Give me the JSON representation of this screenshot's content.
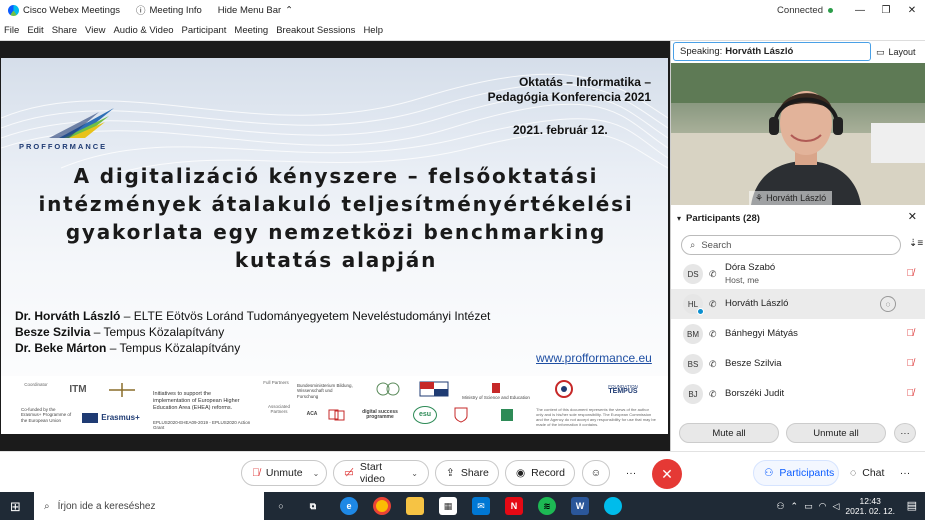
{
  "titlebar": {
    "app_title": "Cisco Webex Meetings",
    "meeting_info": "Meeting Info",
    "hide_menu": "Hide Menu Bar",
    "status": "Connected"
  },
  "menu": [
    "File",
    "Edit",
    "Share",
    "View",
    "Audio & Video",
    "Participant",
    "Meeting",
    "Breakout Sessions",
    "Help"
  ],
  "slide": {
    "logo_text": "PROFFORMANCE",
    "conference_line1": "Oktatás – Informatika –",
    "conference_line2": "Pedagógia Konferencia 2021",
    "date": "2021. február 12.",
    "title_line1": "A digitalizáció kényszere – felsőoktatási",
    "title_line2": "intézmények átalakuló teljesítményértékelési",
    "title_line3": "gyakorlata egy nemzetközi benchmarking",
    "title_line4": "kutatás alapján",
    "authors": [
      {
        "name": "Dr. Horváth László",
        "affiliation": " – ELTE Eötvös Loránd Tudományegyetem Neveléstudományi Intézet"
      },
      {
        "name": "Besze Szilvia",
        "affiliation": " – Tempus Közalapítvány"
      },
      {
        "name": "Dr. Beke Márton",
        "affiliation": " – Tempus Közalapítvány"
      }
    ],
    "url": "www.profformance.eu",
    "footer": {
      "coordinator": "Coordinator",
      "co_funded": "Co-funded by the Erasmus+ Programme of the European Union",
      "erasmus": "Erasmus+",
      "itm": "ITM",
      "initiative": "Initiatives to support the implementation of European Higher Education Area (EHEA) reforms.",
      "project_no": "EPLUS2020-EHEA09-2019 - EPLUS2020 Action Grant",
      "full_partners": "Full Partners",
      "associated": "Associated Partners",
      "bmbwf": "Bundesministerium Bildung, Wissenschaft und Forschung",
      "ministry": "Ministry of Science and Education",
      "tempus": "TEMPUS",
      "tempus_sub": "FOUNDATION",
      "aca": "ACA",
      "digital": "digital success programme",
      "esu": "esu",
      "disclaimer": "The content of this document represents the views of the author only and is his/her sole responsibility. The European Commission and the Agency do not accept any responsibility for use that may be made of the information it contains."
    }
  },
  "speaker_panel": {
    "speaking_label": "Speaking:",
    "speaking_name": "Horváth László",
    "layout_label": "Layout",
    "video_name": "Horváth László"
  },
  "participants": {
    "header": "Participants (28)",
    "search_placeholder": "Search",
    "list": [
      {
        "initials": "DS",
        "name": "Dóra Szabó",
        "role": "Host, me"
      },
      {
        "initials": "HL",
        "name": "Horváth László",
        "role": ""
      },
      {
        "initials": "BM",
        "name": "Bánhegyi Mátyás",
        "role": ""
      },
      {
        "initials": "BS",
        "name": "Besze Szilvia",
        "role": ""
      },
      {
        "initials": "BJ",
        "name": "Borszéki Judit",
        "role": ""
      }
    ],
    "mute_all": "Mute all",
    "unmute_all": "Unmute all",
    "more": "···"
  },
  "controls": {
    "unmute": "Unmute",
    "start_video": "Start video",
    "share": "Share",
    "record": "Record",
    "emoji": "☺",
    "more": "···",
    "end": "✕",
    "participants_tab": "Participants",
    "chat_tab": "Chat",
    "more_right": "···"
  },
  "taskbar": {
    "search_placeholder": "Írjon ide a kereséshez",
    "time": "12:43",
    "date": "2021. 02. 12."
  },
  "colors": {
    "end_red": "#e53935",
    "accent_blue": "#0b5cff",
    "link_blue": "#1f4fa3",
    "taskbar": "#1f2a36"
  }
}
